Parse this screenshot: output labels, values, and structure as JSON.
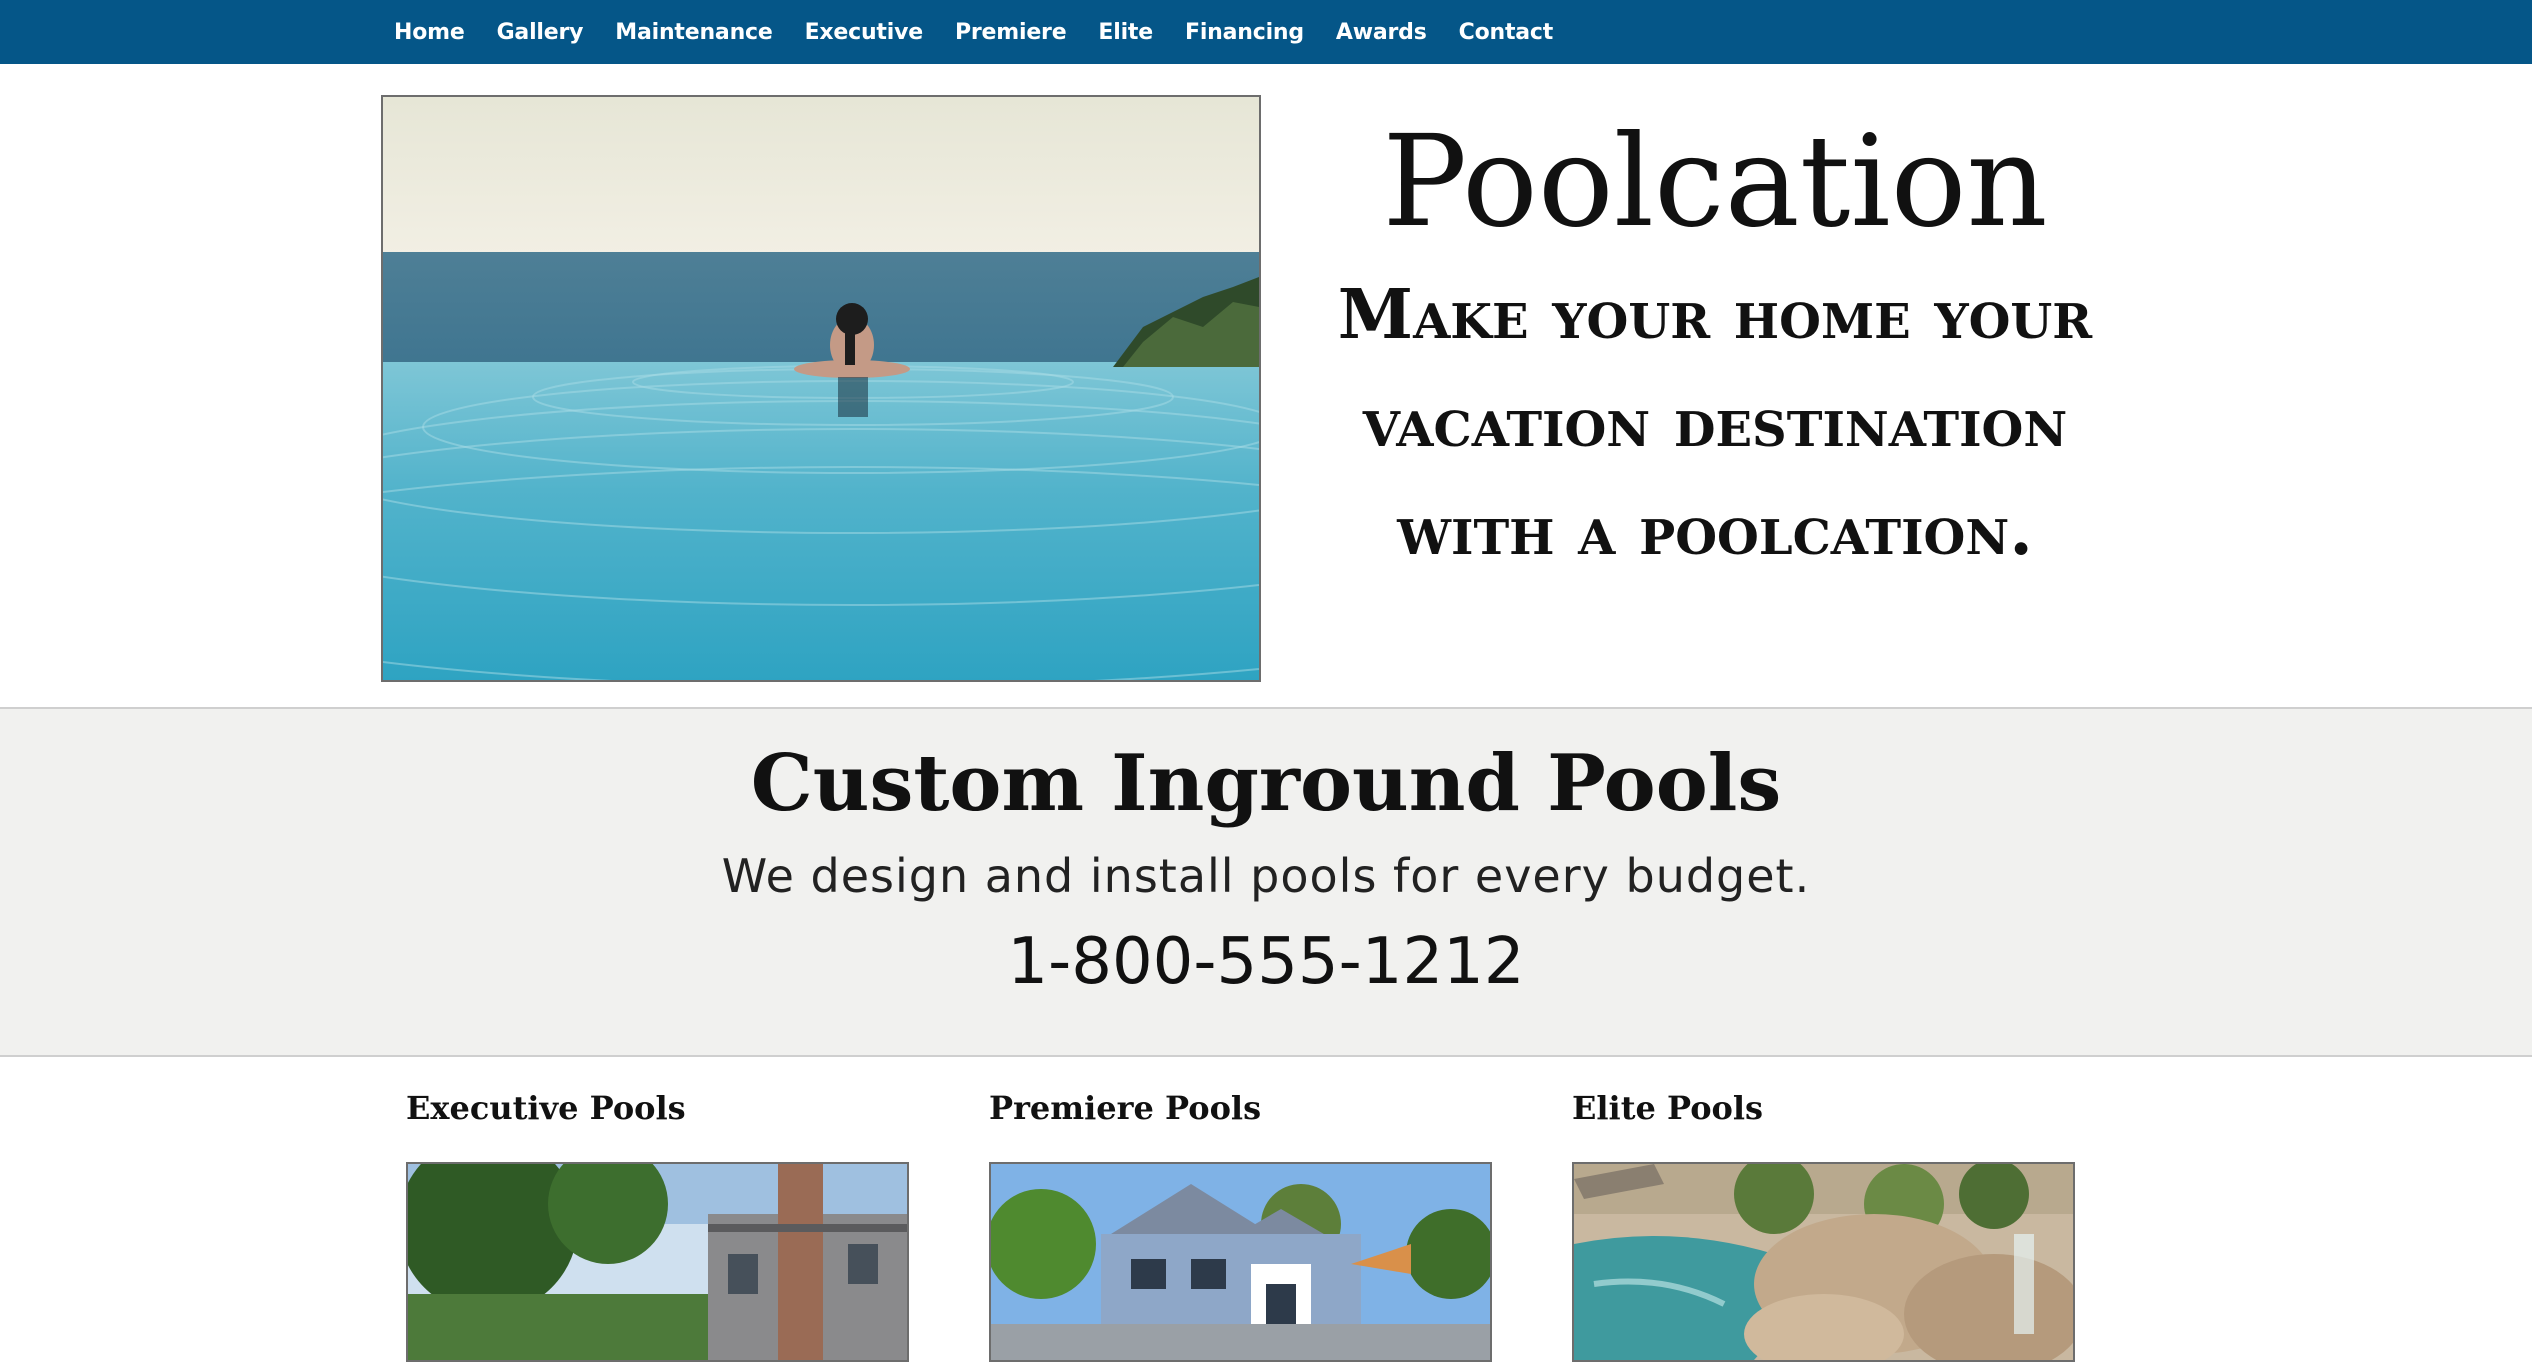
{
  "nav": {
    "items": [
      "Home",
      "Gallery",
      "Maintenance",
      "Executive",
      "Premiere",
      "Elite",
      "Financing",
      "Awards",
      "Contact"
    ]
  },
  "hero": {
    "title": "Poolcation",
    "tagline": "Make your home your vacation destination with a poolcation.",
    "image_alt": "woman in infinity pool overlooking ocean"
  },
  "band": {
    "title": "Custom Inground Pools",
    "subtitle": "We design and install pools for every budget.",
    "phone": "1-800-555-1212"
  },
  "cards": [
    {
      "title": "Executive Pools",
      "image_alt": "brick house with trees"
    },
    {
      "title": "Premiere Pools",
      "image_alt": "blue house with pool"
    },
    {
      "title": "Elite Pools",
      "image_alt": "rock grotto pool"
    }
  ],
  "colors": {
    "nav_bg": "#055688",
    "band_bg": "#f1f1ef"
  }
}
